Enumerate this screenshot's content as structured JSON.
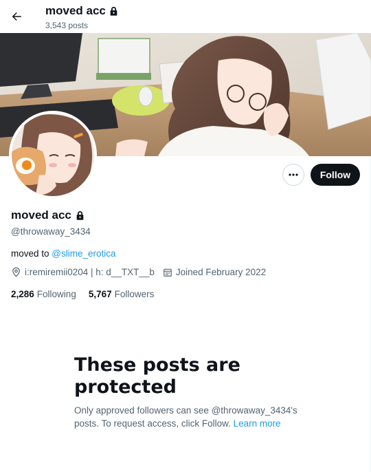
{
  "header": {
    "name": "moved acc",
    "post_count": "3,543 posts"
  },
  "profile": {
    "display_name": "moved acc",
    "handle": "@throwaway_3434",
    "bio_prefix": "moved to",
    "bio_link": "@slime_erotica",
    "location": "i:remiremii0204 | h: d__TXT__b",
    "joined": "Joined February 2022",
    "following_count": "2,286",
    "following_label": "Following",
    "followers_count": "5,767",
    "followers_label": "Followers"
  },
  "actions": {
    "follow_label": "Follow"
  },
  "protected": {
    "title_line1": "These posts are",
    "title_line2": "protected",
    "body_line1": "Only approved followers can see @throwaway_3434's",
    "body_line2": "posts. To request access, click Follow.",
    "learn_more": "Learn more"
  },
  "colors": {
    "accent": "#1d9bf0",
    "text": "#0f1419",
    "secondary": "#536471",
    "follow_bg": "#0f1419"
  }
}
